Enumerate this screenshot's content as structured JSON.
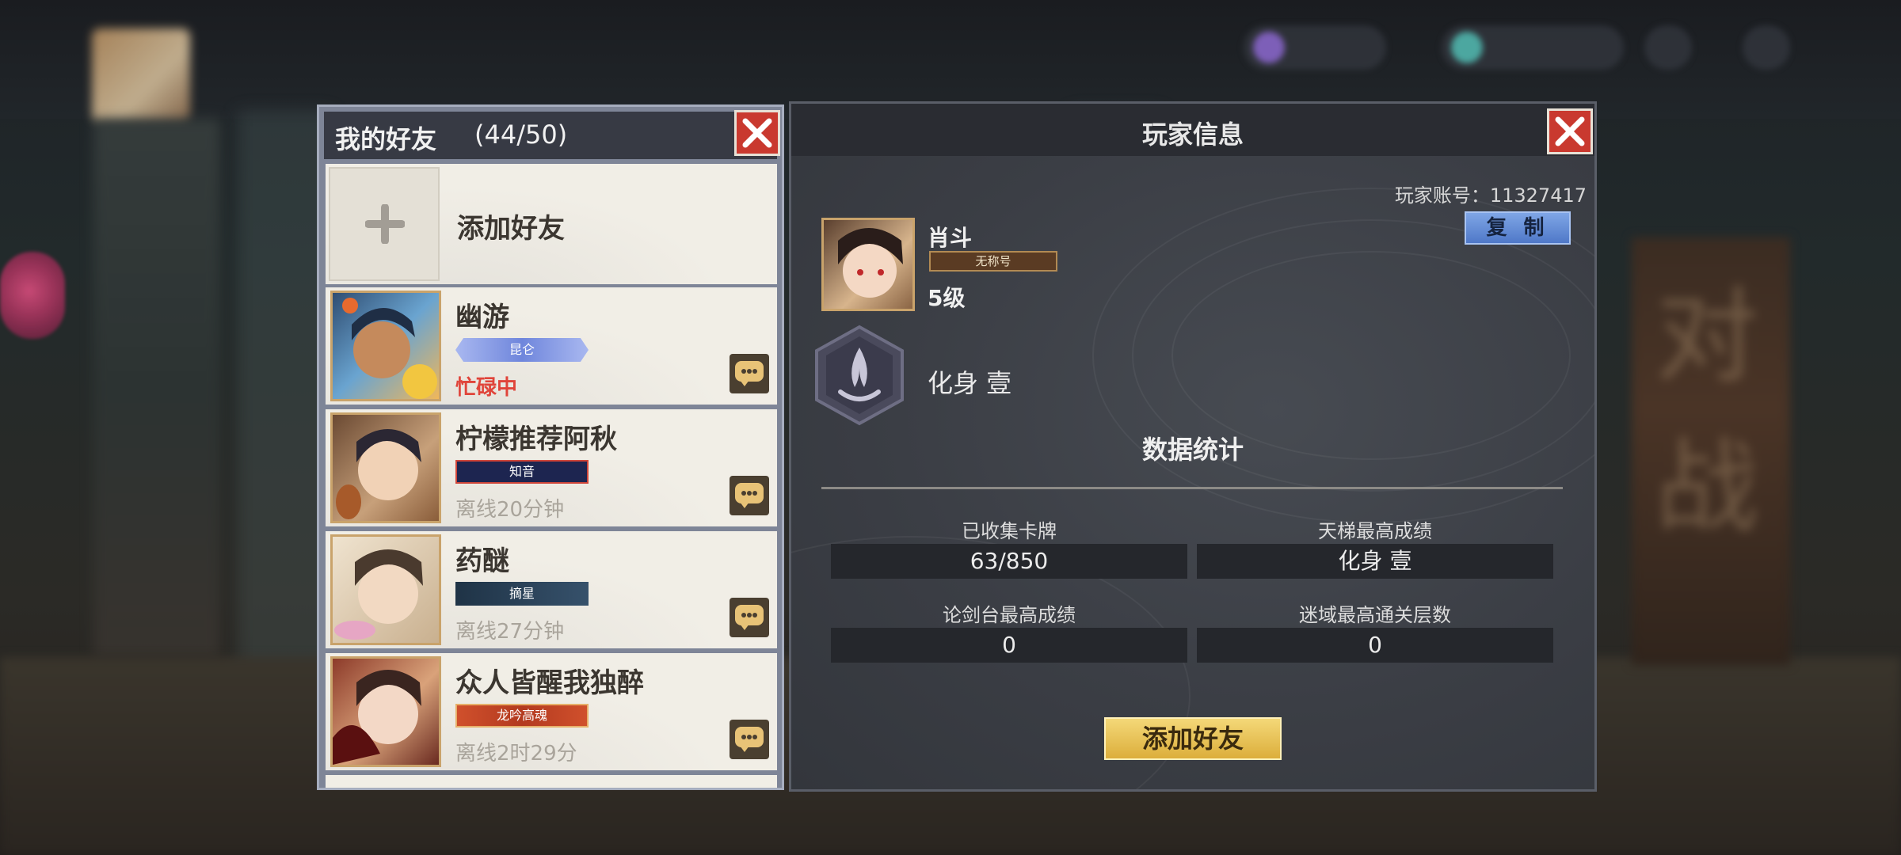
{
  "friends_panel": {
    "title": "我的好友",
    "count": "(44/50)",
    "add_friend_label": "添加好友",
    "friends": [
      {
        "name": "幽游",
        "title": "昆仑",
        "status": "忙碌中",
        "busy": true,
        "title_color": "#7b8fe0"
      },
      {
        "name": "柠檬推荐阿秋",
        "title": "知音",
        "status": "离线20分钟",
        "busy": false,
        "title_color": "#1d2550"
      },
      {
        "name": "药醚",
        "title": "摘星",
        "status": "离线27分钟",
        "busy": false,
        "title_color": "#1f3346"
      },
      {
        "name": "众人皆醒我独醉",
        "title": "龙吟高魂",
        "status": "离线2时29分",
        "busy": false,
        "title_color": "#b33a1f"
      }
    ]
  },
  "player_panel": {
    "title": "玩家信息",
    "account_label": "玩家账号：11327417",
    "copy_label": "复 制",
    "name": "肖斗",
    "player_title": "无称号",
    "level": "5级",
    "rank": "化身 壹",
    "stats_title": "数据统计",
    "stats": [
      {
        "label": "已收集卡牌",
        "value": "63/850"
      },
      {
        "label": "天梯最高成绩",
        "value": "化身 壹"
      },
      {
        "label": "论剑台最高成绩",
        "value": "0"
      },
      {
        "label": "迷域最高通关层数",
        "value": "0"
      }
    ],
    "add_button_label": "添加好友"
  },
  "background": {
    "side_text": "对战"
  },
  "colors": {
    "close_red": "#c9392f",
    "busy_red": "#e0443a",
    "gold_button": "#e8c24f",
    "copy_blue": "#5f86d4"
  }
}
